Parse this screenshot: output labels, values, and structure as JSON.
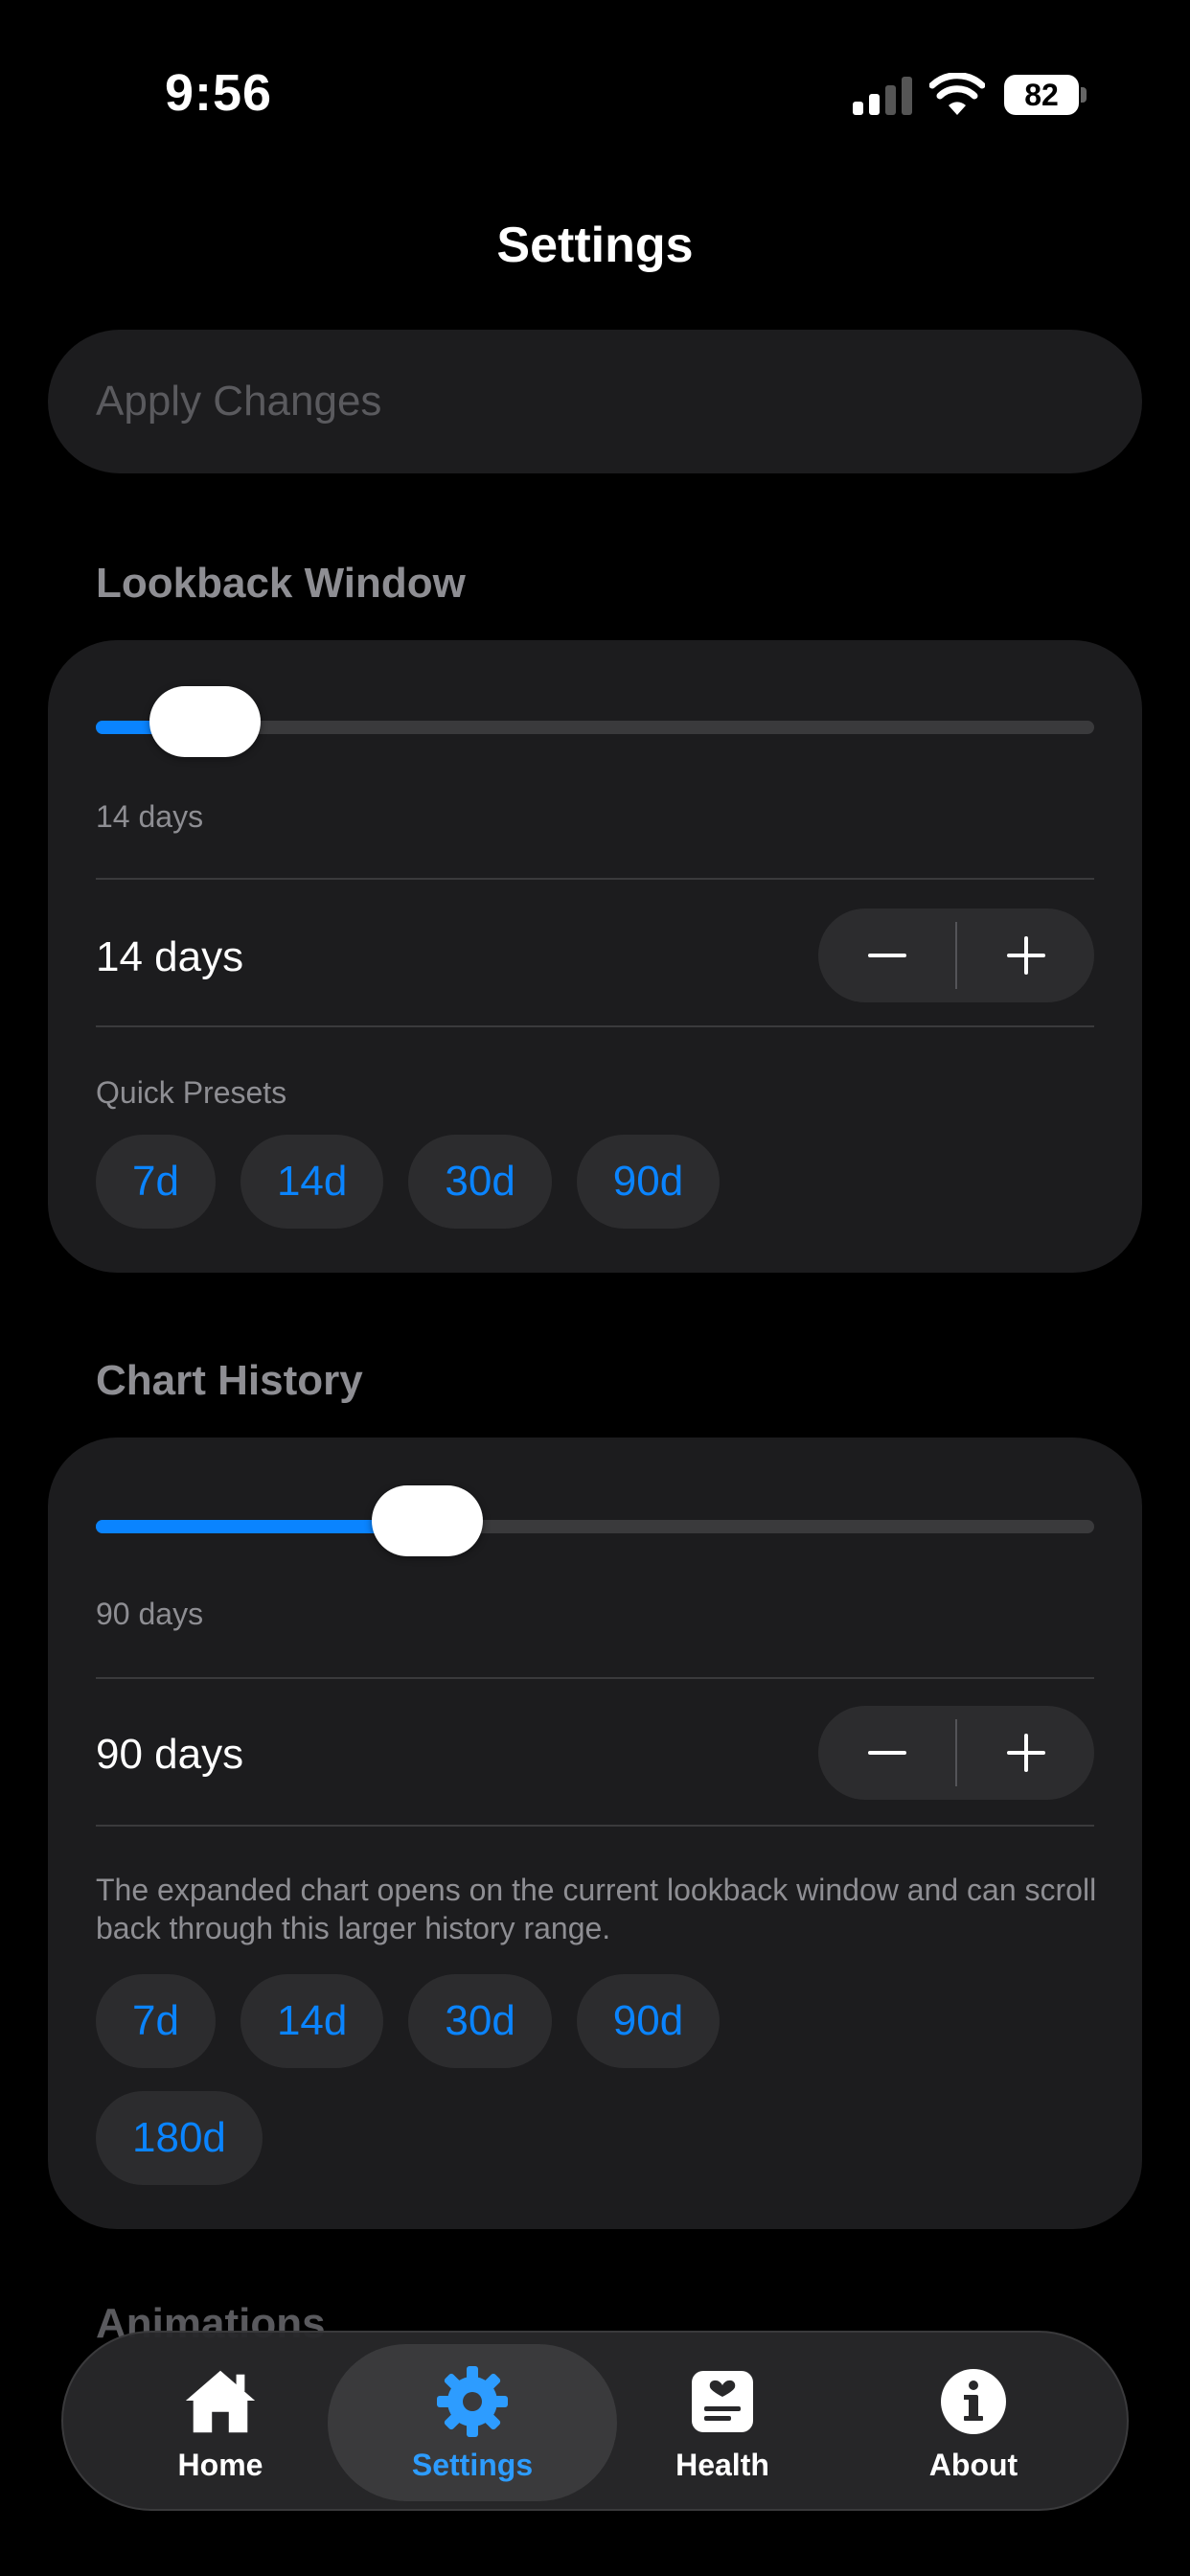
{
  "status_bar": {
    "time": "9:56",
    "battery": "82"
  },
  "page": {
    "title": "Settings"
  },
  "apply_button": {
    "label": "Apply Changes"
  },
  "lookback": {
    "header": "Lookback Window",
    "slider_value_fraction": 0.05,
    "slider_label": "14 days",
    "value_text": "14 days",
    "presets_label": "Quick Presets",
    "presets": [
      "7d",
      "14d",
      "30d",
      "90d"
    ]
  },
  "chart_history": {
    "header": "Chart History",
    "slider_value_fraction": 0.3,
    "slider_label": "90 days",
    "value_text": "90 days",
    "description": "The expanded chart opens on the current lookback window and can scroll back through this larger history range.",
    "presets": [
      "7d",
      "14d",
      "30d",
      "90d"
    ],
    "presets_row2": [
      "180d"
    ]
  },
  "next_section_header": "Animations",
  "tabs": [
    {
      "label": "Home",
      "icon": "home-icon",
      "active": false
    },
    {
      "label": "Settings",
      "icon": "gear-icon",
      "active": true
    },
    {
      "label": "Health",
      "icon": "health-icon",
      "active": false
    },
    {
      "label": "About",
      "icon": "info-icon",
      "active": false
    }
  ],
  "colors": {
    "accent": "#0a84ff",
    "tab_active": "#2d9cff",
    "card": "#1c1c1e",
    "background": "#000000"
  }
}
